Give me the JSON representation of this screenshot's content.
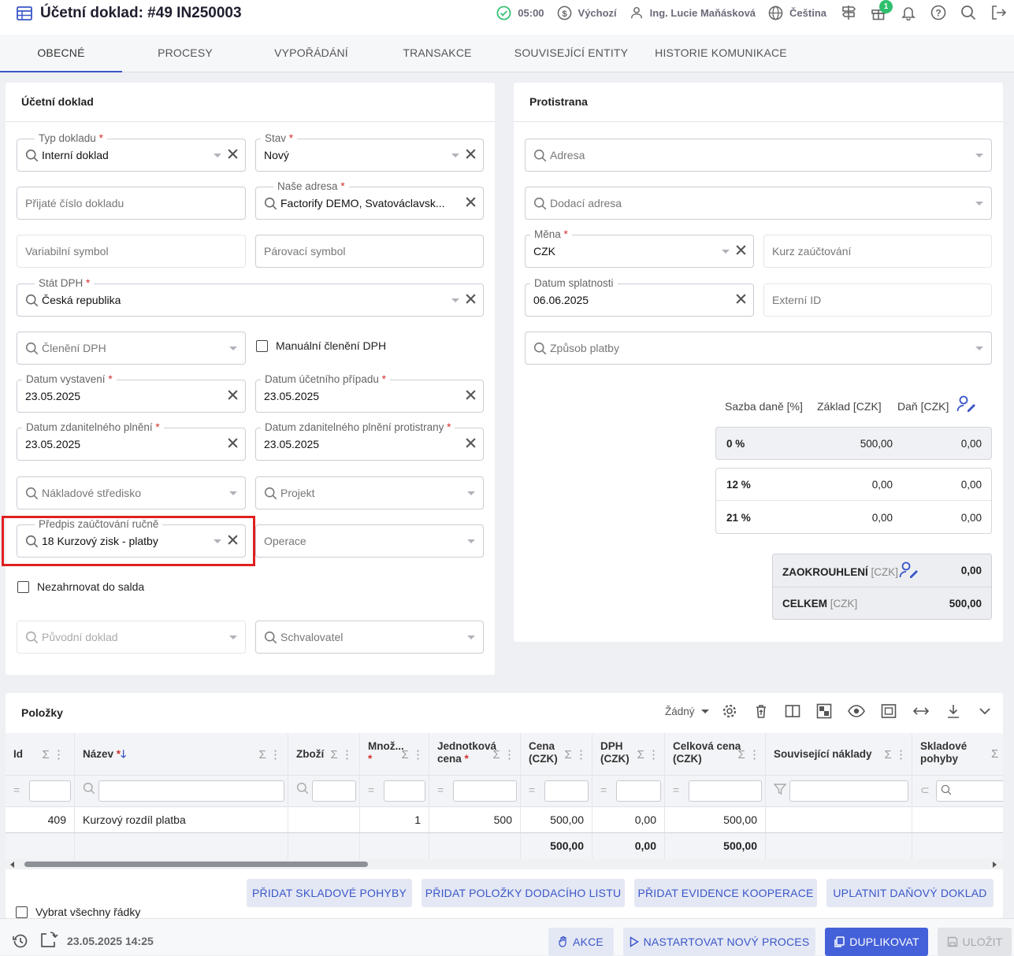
{
  "header": {
    "title": "Účetní doklad: #49 IN250003",
    "time": "05:00",
    "profile": "Výchozí",
    "user": "Ing. Lucie Maňásková",
    "language": "Čeština",
    "notification_count": "1"
  },
  "tabs": [
    "OBECNÉ",
    "PROCESY",
    "VYPOŘÁDÁNÍ",
    "TRANSAKCE",
    "SOUVISEJÍCÍ ENTITY",
    "HISTORIE KOMUNIKACE"
  ],
  "left_panel": {
    "title": "Účetní doklad",
    "typ_dokladu": {
      "label": "Typ dokladu",
      "value": "Interní doklad"
    },
    "stav": {
      "label": "Stav",
      "value": "Nový"
    },
    "prijate_cislo": {
      "placeholder": "Přijaté číslo dokladu"
    },
    "nase_adresa": {
      "label": "Naše adresa",
      "value": "Factorify DEMO, Svatováclavsk..."
    },
    "variabilni_symbol": {
      "placeholder": "Variabilní symbol"
    },
    "parovaci_symbol": {
      "placeholder": "Párovací symbol"
    },
    "stat_dph": {
      "label": "Stát DPH",
      "value": "Česká republika"
    },
    "cleneni_dph": {
      "placeholder": "Členění DPH"
    },
    "manualni_cleneni": {
      "label": "Manuální členění DPH"
    },
    "datum_vystaveni": {
      "label": "Datum vystavení",
      "value": "23.05.2025"
    },
    "datum_ucetniho_pripadu": {
      "label": "Datum účetního případu",
      "value": "23.05.2025"
    },
    "datum_zdanitelneho": {
      "label": "Datum zdanitelného plnění",
      "value": "23.05.2025"
    },
    "datum_zdanitelneho_protistrany": {
      "label": "Datum zdanitelného plnění protistrany",
      "value": "23.05.2025"
    },
    "nakladove_stredisko": {
      "placeholder": "Nákladové středisko"
    },
    "projekt": {
      "placeholder": "Projekt"
    },
    "predpis": {
      "label": "Předpis zaúčtování ručně",
      "value": "18 Kurzový zisk - platby"
    },
    "operace": {
      "placeholder": "Operace"
    },
    "nezahrnovat": {
      "label": "Nezahrnovat do salda"
    },
    "puvodni_doklad": {
      "placeholder": "Původní doklad"
    },
    "schvalovatel": {
      "placeholder": "Schvalovatel"
    }
  },
  "right_panel": {
    "title": "Protistrana",
    "adresa": {
      "placeholder": "Adresa"
    },
    "dodaci_adresa": {
      "placeholder": "Dodací adresa"
    },
    "mena": {
      "label": "Měna",
      "value": "CZK"
    },
    "kurz": {
      "placeholder": "Kurz zaúčtování"
    },
    "datum_splatnosti": {
      "label": "Datum splatnosti",
      "value": "06.06.2025"
    },
    "externi_id": {
      "placeholder": "Externí ID"
    },
    "zpusob_platby": {
      "placeholder": "Způsob platby"
    },
    "vat_headers": [
      "Sazba daně [%]",
      "Základ [CZK]",
      "Daň [CZK]"
    ],
    "vat_rows": [
      {
        "rate": "0 %",
        "base": "500,00",
        "tax": "0,00"
      },
      {
        "rate": "12 %",
        "base": "0,00",
        "tax": "0,00"
      },
      {
        "rate": "21 %",
        "base": "0,00",
        "tax": "0,00"
      }
    ],
    "rounding": {
      "label": "ZAOKROUHLENÍ",
      "unit": "[CZK]",
      "value": "0,00"
    },
    "total": {
      "label": "CELKEM",
      "unit": "[CZK]",
      "value": "500,00"
    }
  },
  "items": {
    "title": "Položky",
    "view_select": "Žádný",
    "columns": [
      {
        "l1": "Id",
        "l2": ""
      },
      {
        "l1": "Název",
        "l2": ""
      },
      {
        "l1": "Zboží",
        "l2": ""
      },
      {
        "l1": "Množ...",
        "l2": ""
      },
      {
        "l1": "Jednotková",
        "l2": "cena"
      },
      {
        "l1": "Cena",
        "l2": "(CZK)"
      },
      {
        "l1": "DPH",
        "l2": "(CZK)"
      },
      {
        "l1": "Celková cena",
        "l2": "(CZK)"
      },
      {
        "l1": "Související náklady",
        "l2": ""
      },
      {
        "l1": "Skladové",
        "l2": "pohyby"
      }
    ],
    "row": {
      "id": "409",
      "nazev": "Kurzový rozdíl platba",
      "mnozstvi": "1",
      "jednotkova": "500",
      "cena": "500,00",
      "dph": "0,00",
      "celkova": "500,00"
    },
    "totals": {
      "cena": "500,00",
      "dph": "0,00",
      "celkova": "500,00"
    },
    "buttons": [
      "PŘIDAT SKLADOVÉ POHYBY",
      "PŘIDAT POLOŽKY DODACÍHO LISTU",
      "PŘIDAT EVIDENCE KOOPERACE",
      "UPLATNIT DAŇOVÝ DOKLAD"
    ],
    "select_all": "Vybrat všechny řádky"
  },
  "footer": {
    "timestamp": "23.05.2025 14:25",
    "akce": "AKCE",
    "nastartovat": "NASTARTOVAT NOVÝ PROCES",
    "duplikovat": "DUPLIKOVAT",
    "ulozit": "ULOŽIT"
  },
  "colors": {
    "accent": "#3a56c8",
    "required": "#d0312d",
    "success": "#2ebf6d",
    "highlight": "#e02020"
  }
}
